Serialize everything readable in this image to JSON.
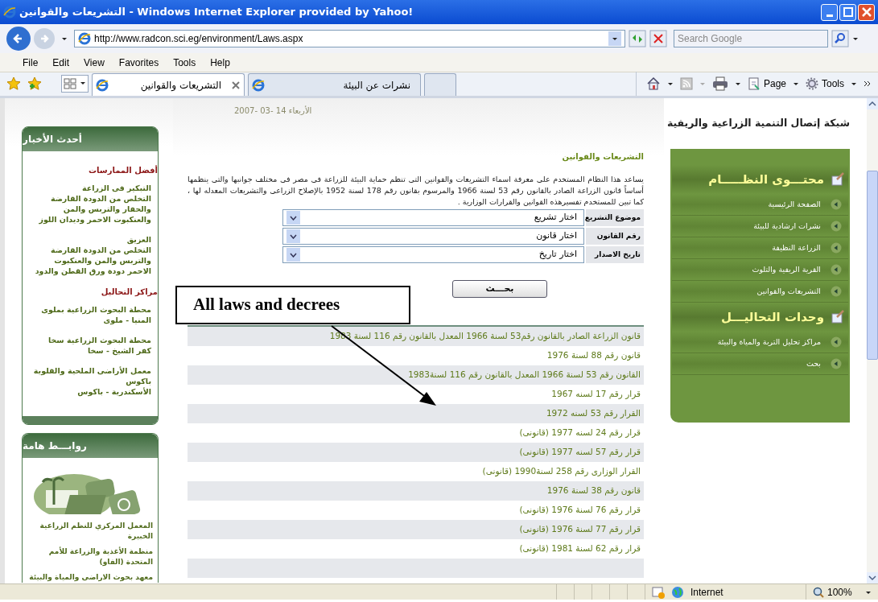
{
  "window": {
    "title": "التشريعات والقوانين - Windows Internet Explorer provided by Yahoo!"
  },
  "address_bar": {
    "url": "http://www.radcon.sci.eg/environment/Laws.aspx",
    "search_placeholder": "Search Google"
  },
  "menu": {
    "file": "File",
    "edit": "Edit",
    "view": "View",
    "favorites": "Favorites",
    "tools": "Tools",
    "help": "Help"
  },
  "tabs": {
    "left": {
      "label": "التشريعات والقوانين",
      "selected": true
    },
    "middle": {
      "label": "نشرات عن البيئة",
      "selected": false
    },
    "right": {
      "selected": false
    }
  },
  "command_bar": {
    "page": "Page",
    "tools": "Tools"
  },
  "left_sidebar": {
    "news": {
      "title": "أحدث الأخبار",
      "sections": [
        {
          "heading": "أفضل الممارسات",
          "items": [
            {
              "title": "التبكير فى الزراعة",
              "text": "التخلص من الدودة القارضة والحفار والتربس والمن والعنكبوت الاحمر وديدان اللوز"
            },
            {
              "title": "العزيق",
              "text": "التخلص من الدودة القارضة والتربس والمن والعنكبوت الاحمر دودة ورق القطن والدود"
            }
          ]
        },
        {
          "heading": "مراكز التحاليل",
          "items": [
            {
              "title": "محطة البحوث الزراعية بملوى",
              "text": "المنيا - ملوى"
            },
            {
              "title": "محطة البحوث الزراعية سخا",
              "text": "كفر الشيخ - سخا"
            },
            {
              "title": "معمل الأراضى الملحية والقلوية باكوس",
              "text": "الأسكندرية - باكوس"
            }
          ]
        }
      ]
    },
    "links": {
      "title": "روابـــط هامة",
      "items": [
        "المعمل المركزي للنظم الزراعية الخبيرة",
        "منظمة الأغذية والزراعة للأمم المتحدة (الفاو)",
        "معهد بحوث الاراضى والمياة والبيئة"
      ]
    }
  },
  "main": {
    "date": "الأربعاء 14 -03 -2007",
    "heading": "التشريعات والقوانين",
    "description": "يساعد هذا النظام المستخدم على معرفة اسماء التشريعات والقوانين التى تنظم حماية البيئة للزراعة فى مصر فى مختلف جوانبها والتى ينظمها أساساً قانون الزراعة الصادر بالقانون رقم 53 لسنة 1966 والمرسوم بقانون رقم 178 لسنة 1952 بالإصلاح الزراعى والتشريعات المعدله لها ، كما تبين للمستخدم تفسيرهذه القوانين والقرارات الوزارية .",
    "form": [
      {
        "label": "موضوع التشريع",
        "value": "اختار تشريع"
      },
      {
        "label": "رقم القانون",
        "value": "اختار قانون"
      },
      {
        "label": "تاريخ الاصدار",
        "value": "اختار تاريخ"
      }
    ],
    "search_button": "بحـــث",
    "laws": [
      "قانون الزراعة الصادر بالقانون رقم53 لسنة 1966 المعدل بالقانون رقم 116 لسنة 1983",
      "قانون رقم 88 لسنة 1976",
      "القانون رقم 53 لسنة 1966 المعدل بالقانون رقم 116 لسنة1983",
      "قرار رقم 17 لسنه 1967",
      "القرار رقم 53 لسنه 1972",
      "قرار رقم 24 لسنه 1977 (قانونى)",
      "قرار رقم 57 لسنه 1977 (قانونى)",
      "القرار الوزارى رقم 258 لسنة1990 (قانونى)",
      "قانون رقم 38 لسنة 1976",
      "قرار رقم 76 لسنة 1976 (قانونى)",
      "قرار رقم 77 لسنة 1976 (قانونى)",
      "قرار رقم 62 لسنة 1981 (قانونى)"
    ],
    "annotation": "All laws and decrees"
  },
  "right_sidebar": {
    "site_title": "شبكة إتصال التنمية الزراعية والريفية",
    "sections": [
      {
        "title": "محتـــوى النظـــــام",
        "items": [
          "الصفحة الرئيسية",
          "نشرات ارشادية للبيئة",
          "الزراعة النظيفة",
          "القرية الريفية والتلوث",
          "التشريعات والقوانين"
        ]
      },
      {
        "title": "وحدات التحاليـــل",
        "items": [
          "مراكز تحليل التربة والمياة والبيئة",
          "بحث"
        ]
      }
    ]
  },
  "status_bar": {
    "zone": "Internet",
    "zoom": "100%"
  }
}
